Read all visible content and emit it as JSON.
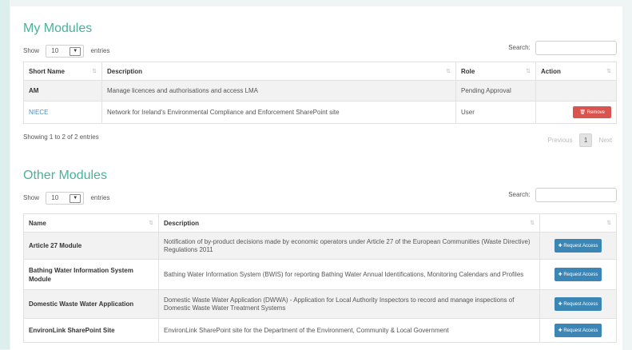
{
  "my_modules": {
    "title": "My Modules",
    "show_label": "Show",
    "entries_value": "10",
    "entries_label": "entries",
    "search_label": "Search:",
    "columns": [
      "Short Name",
      "Description",
      "Role",
      "Action"
    ],
    "rows": [
      {
        "short_name": "AM",
        "description": "Manage licences and authorisations and access LMA",
        "role": "Pending Approval",
        "action": ""
      },
      {
        "short_name": "NIECE",
        "description": "Network for Ireland's Environmental Compliance and Enforcement SharePoint site",
        "role": "User",
        "action": "Remove"
      }
    ],
    "showing": "Showing 1 to 2 of 2 entries",
    "pager": {
      "previous": "Previous",
      "current": "1",
      "next": "Next"
    }
  },
  "other_modules": {
    "title": "Other Modules",
    "show_label": "Show",
    "entries_value": "10",
    "entries_label": "entries",
    "search_label": "Search:",
    "columns": [
      "Name",
      "Description",
      ""
    ],
    "rows": [
      {
        "name": "Article 27 Module",
        "description": "Notification of by-product decisions made by economic operators under Article 27 of the European Communities (Waste Directive) Regulations 2011",
        "action": "Request Access"
      },
      {
        "name": "Bathing Water Information System Module",
        "description": "Bathing Water Information System (BWIS) for reporting Bathing Water Annual Identifications, Monitoring Calendars and Profiles",
        "action": "Request Access"
      },
      {
        "name": "Domestic Waste Water Application",
        "description": "Domestic Waste Water Application (DWWA) - Application for Local Authority Inspectors to record and manage inspections of Domestic Waste Water Treatment Systems",
        "action": "Request Access"
      },
      {
        "name": "EnvironLink SharePoint Site",
        "description": "EnvironLink SharePoint site for the Department of the Environment, Community & Local Government",
        "action": "Request Access"
      }
    ]
  },
  "icons": {
    "sort": "sort-icon",
    "remove": "trash-icon",
    "request": "plus-icon"
  },
  "colors": {
    "heading": "#4bb09a",
    "remove": "#d9534f",
    "request": "#3c86b5",
    "link": "#4a90c2"
  }
}
